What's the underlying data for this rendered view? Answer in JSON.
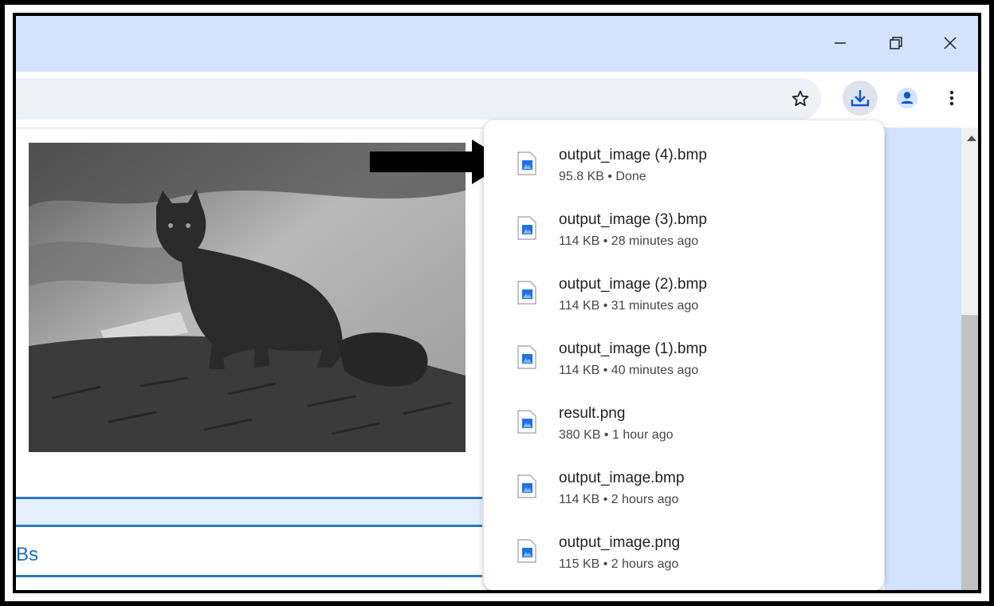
{
  "window_controls": {
    "minimize_icon": "minimize-icon",
    "restore_icon": "restore-icon",
    "close_icon": "close-icon"
  },
  "toolbar": {
    "bookmark_icon": "star-outline-icon",
    "download_icon": "download-icon",
    "profile_icon": "person-icon",
    "menu_icon": "kebab-menu-icon"
  },
  "page": {
    "partial_text": "Bs"
  },
  "downloads": [
    {
      "name": "output_image (4).bmp",
      "meta": "95.8 KB • Done"
    },
    {
      "name": "output_image (3).bmp",
      "meta": "114 KB • 28 minutes ago"
    },
    {
      "name": "output_image (2).bmp",
      "meta": "114 KB • 31 minutes ago"
    },
    {
      "name": "output_image (1).bmp",
      "meta": "114 KB • 40 minutes ago"
    },
    {
      "name": "result.png",
      "meta": "380 KB • 1 hour ago"
    },
    {
      "name": "output_image.bmp",
      "meta": "114 KB • 2 hours ago"
    },
    {
      "name": "output_image.png",
      "meta": "115 KB • 2 hours ago"
    }
  ],
  "colors": {
    "titlebar": "#d3e3fd",
    "accent_blue": "#0b57d0",
    "link_blue": "#1a6fc2"
  }
}
